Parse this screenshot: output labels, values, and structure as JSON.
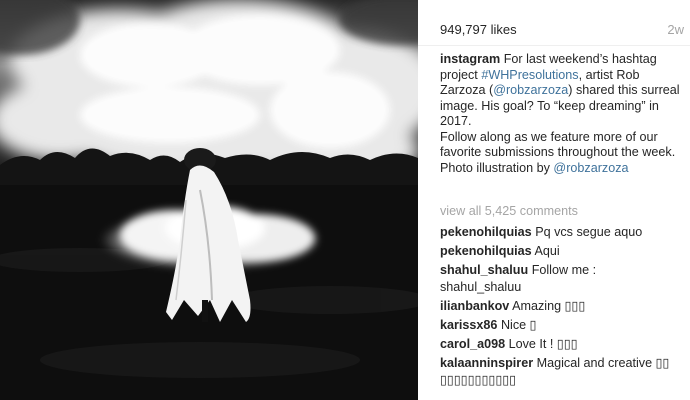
{
  "post": {
    "likes": "949,797 likes",
    "time": "2w",
    "caption": {
      "user": "instagram",
      "text_1": "For last weekend’s hashtag project",
      "hashtag": "#WHPresolutions",
      "text_2": ", artist Rob Zarzoza (",
      "mention": "@robzarzoza",
      "text_3": ") shared this surreal image. His goal? To “keep dreaming” in 2017.",
      "text_4": "Follow along as we feature more of our favorite submissions throughout the week.",
      "text_5": "Photo illustration by",
      "credit": "@robzarzoza"
    },
    "view_all": "view all 5,425 comments"
  },
  "comments": [
    {
      "user": "pekenohilquias",
      "text": "Pq vcs segue aquo"
    },
    {
      "user": "pekenohilquias",
      "text": "Aqui"
    },
    {
      "user": "shahul_shaluu",
      "text": "Follow me : shahul_shaluu"
    },
    {
      "user": "ilianbankov",
      "text": "Amazing ▯▯▯"
    },
    {
      "user": "karissx86",
      "text": "Nice ▯"
    },
    {
      "user": "carol_a098",
      "text": "Love It ! ▯▯▯"
    },
    {
      "user": "kalaanninspirer",
      "text": "Magical and creative ▯▯ ▯▯▯▯▯▯▯▯▯▯▯"
    }
  ],
  "colors": {
    "text": "#262626",
    "link": "#3f729b",
    "muted": "#a5a5a5"
  }
}
